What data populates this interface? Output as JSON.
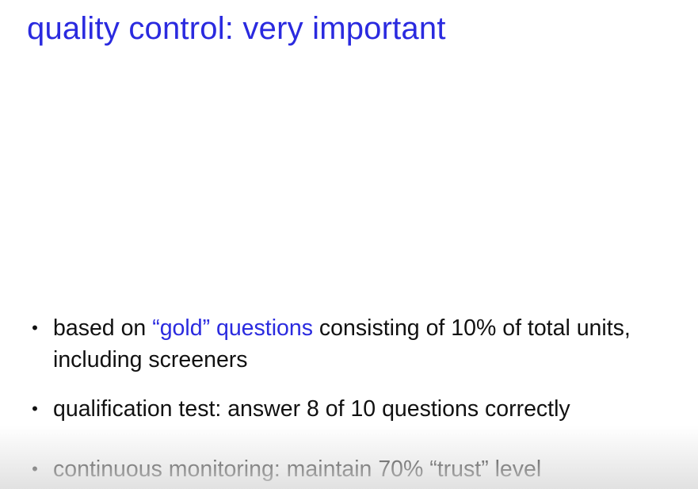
{
  "slide": {
    "title": "quality control: very important",
    "bullets": [
      {
        "highlight": "“gold” questions",
        "before": "based on ",
        "after": " consisting of 10% of total units, including screeners"
      },
      {
        "text": "qualification test: answer 8 of 10 questions correctly"
      },
      {
        "text": "continuous monitoring: maintain 70% “trust” level"
      }
    ],
    "bullet_glyph": "•",
    "colors": {
      "title": "#2a2adf",
      "highlight": "#2a2adf",
      "body_text": "#111111",
      "background": "#ffffff"
    }
  }
}
